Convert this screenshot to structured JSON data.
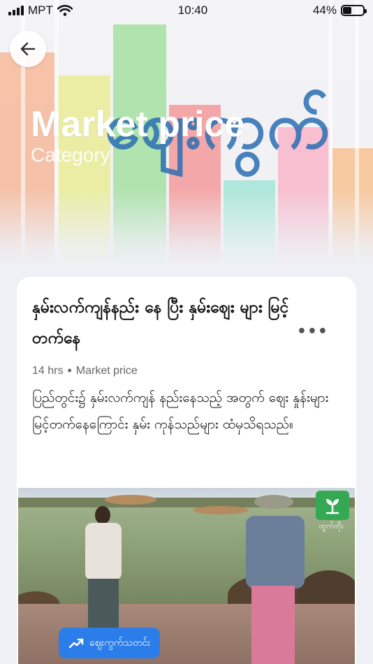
{
  "status_bar": {
    "carrier": "MPT",
    "time": "10:40",
    "battery": "44%",
    "battery_level": 0.44
  },
  "banner": {
    "title_burmese": "ဈေးကွက်",
    "title_english": "Market price",
    "subtitle": "Category",
    "back_icon": "arrow-left-icon"
  },
  "article": {
    "title": "နှမ်းလက်ကျန်နည်း နေ ပြီး နှမ်းဈေး များ မြင့်တက်နေ",
    "more_label": "•••",
    "time_ago": "14 hrs",
    "category": "Market price",
    "body": "ပြည်တွင်း၌ နှမ်းလက်ကျန် နည်းနေသည့် အတွက် ဈေး နှုန်းများ မြင့်တက်နေကြောင်း နှမ်း ကုန်သည်များ ထံမှသိရသည်။",
    "photo": {
      "logo_text": "ထွက်တိုး",
      "chip_label": "ဈေးကွက်သတင်း",
      "chip_icon": "trending-up-icon",
      "brand_color": "#34a853",
      "chip_color": "#2b7de9"
    }
  }
}
